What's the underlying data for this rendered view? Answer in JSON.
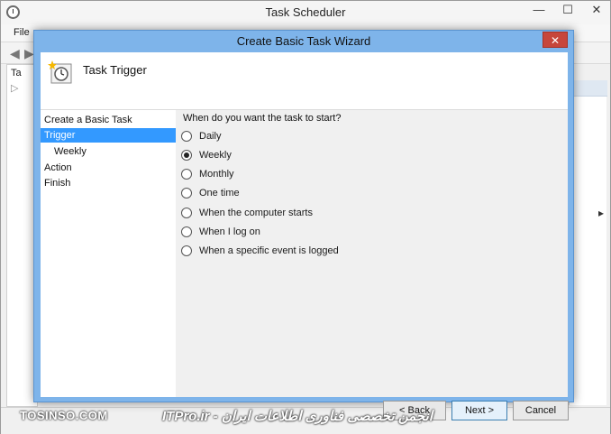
{
  "outer_window": {
    "title": "Task Scheduler",
    "menu_file": "File",
    "tree_fragment": "Ta",
    "controls": {
      "minimize": "—",
      "maximize": "☐",
      "close": "✕"
    }
  },
  "wizard": {
    "title": "Create Basic Task Wizard",
    "close_glyph": "✕",
    "header_title": "Task Trigger",
    "steps": [
      {
        "label": "Create a Basic Task"
      },
      {
        "label": "Trigger"
      },
      {
        "label": "Weekly"
      },
      {
        "label": "Action"
      },
      {
        "label": "Finish"
      }
    ],
    "question": "When do you want the task to start?",
    "options": [
      {
        "label": "Daily"
      },
      {
        "label": "Weekly"
      },
      {
        "label": "Monthly"
      },
      {
        "label": "One time"
      },
      {
        "label": "When the computer starts"
      },
      {
        "label": "When I log on"
      },
      {
        "label": "When a specific event is logged"
      }
    ],
    "selected_option": "Weekly",
    "buttons": {
      "back": "< Back",
      "next": "Next >",
      "cancel": "Cancel"
    }
  },
  "watermarks": {
    "left": "TOSINSO.COM",
    "right": "ITPro.ir - انجمن تخصصی فناوری اطلاعات ایران"
  },
  "colors": {
    "wizard_frame": "#7eb4ea",
    "active_step": "#3399ff",
    "close_button": "#c7463b"
  }
}
